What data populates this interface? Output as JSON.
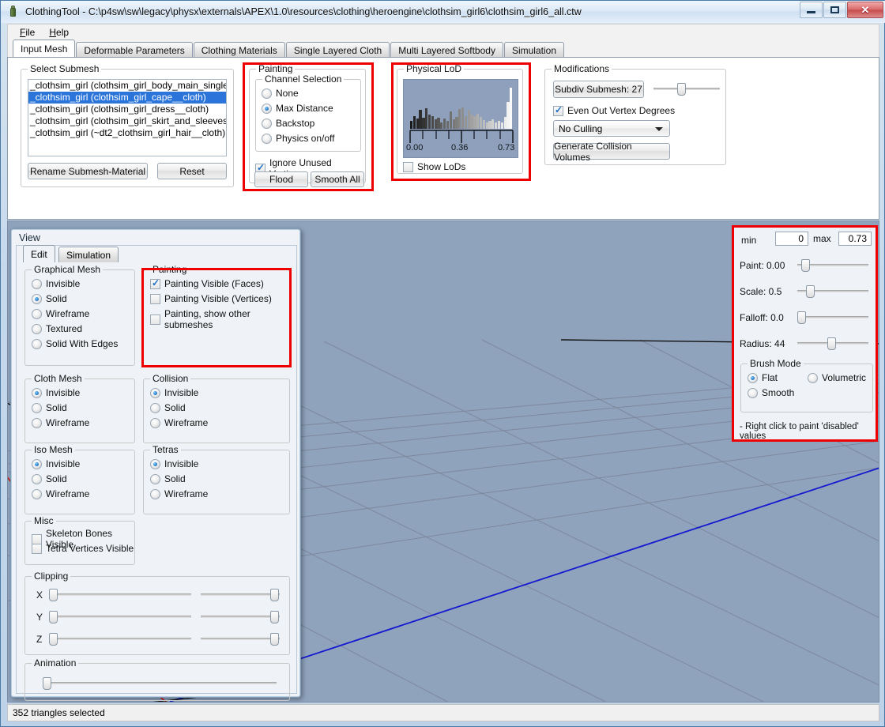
{
  "window": {
    "title": "ClothingTool - C:\\p4sw\\sw\\legacy\\physx\\externals\\APEX\\1.0\\resources\\clothing\\heroengine\\clothsim_girl6\\clothsim_girl6_all.ctw",
    "minimize_label": "Minimize",
    "maximize_label": "Maximize",
    "close_label": "✕",
    "app_icon": "clothing-tool-icon"
  },
  "menu": {
    "items": [
      "File",
      "Help"
    ]
  },
  "tabs": {
    "items": [
      "Input Mesh",
      "Deformable Parameters",
      "Clothing Materials",
      "Single Layered Cloth",
      "Multi Layered Softbody",
      "Simulation"
    ],
    "active": "Input Mesh"
  },
  "select_submesh": {
    "legend": "Select Submesh",
    "items": [
      "_clothsim_girl (clothsim_girl_body_main_single_s",
      "_clothsim_girl (clothsim_girl_cape__cloth)",
      "_clothsim_girl (clothsim_girl_dress__cloth)",
      "_clothsim_girl (clothsim_girl_skirt_and_sleeves__",
      "_clothsim_girl (~dt2_clothsim_girl_hair__cloth)"
    ],
    "selected_index": 1,
    "rename_button": "Rename Submesh-Material",
    "reset_button": "Reset"
  },
  "painting": {
    "legend": "Painting",
    "channel_legend": "Channel Selection",
    "channels": [
      "None",
      "Max Distance",
      "Backstop",
      "Physics on/off"
    ],
    "selected_channel": "Max Distance",
    "ignore_unused_vertices_label": "Ignore Unused Vertices",
    "ignore_unused_vertices_checked": true,
    "flood_button": "Flood",
    "smooth_all_button": "Smooth All"
  },
  "physical_lod": {
    "legend": "Physical LoD",
    "show_lods_label": "Show LoDs",
    "show_lods_checked": false,
    "axis_min_label": "0.00",
    "axis_mid_label": "0.36",
    "axis_max_label": "0.73"
  },
  "chart_data": {
    "type": "bar",
    "title": "Physical LoD",
    "xlabel": "",
    "ylabel": "",
    "xlim": [
      0.0,
      0.73
    ],
    "ylim": [
      0,
      100
    ],
    "grid": false,
    "legend": "none",
    "tick_labels": [
      "0.00",
      "0.36",
      "0.73"
    ],
    "tick_positions": [
      0.0,
      0.36,
      0.73
    ],
    "x": [
      0.05,
      0.07,
      0.09,
      0.11,
      0.13,
      0.15,
      0.17,
      0.19,
      0.21,
      0.23,
      0.25,
      0.27,
      0.29,
      0.31,
      0.33,
      0.35,
      0.37,
      0.39,
      0.41,
      0.43,
      0.45,
      0.47,
      0.49,
      0.51,
      0.53,
      0.55,
      0.57,
      0.59,
      0.61,
      0.63,
      0.65,
      0.67,
      0.69,
      0.71
    ],
    "values": [
      18,
      30,
      24,
      44,
      26,
      48,
      34,
      30,
      22,
      26,
      14,
      24,
      18,
      40,
      22,
      28,
      46,
      50,
      30,
      44,
      34,
      30,
      36,
      28,
      20,
      14,
      18,
      22,
      14,
      18,
      14,
      28,
      62,
      96
    ],
    "bar_colors_gradient": [
      "#1d1d1d",
      "#ffffff"
    ]
  },
  "modifications": {
    "legend": "Modifications",
    "subdiv_button": "Subdiv Submesh: 27",
    "subdiv_slider_value": 27,
    "even_out_label": "Even Out Vertex Degrees",
    "even_out_checked": true,
    "culling_value": "No Culling",
    "generate_button": "Generate Collision Volumes"
  },
  "view_panel": {
    "title": "View",
    "tabs": [
      "Edit",
      "Simulation"
    ],
    "active_tab": "Edit",
    "graphical_mesh": {
      "legend": "Graphical Mesh",
      "options": [
        "Invisible",
        "Solid",
        "Wireframe",
        "Textured",
        "Solid With Edges"
      ],
      "selected": "Solid"
    },
    "painting": {
      "legend": "Painting",
      "options": [
        {
          "label": "Painting Visible (Faces)",
          "checked": true
        },
        {
          "label": "Painting Visible (Vertices)",
          "checked": false
        },
        {
          "label": "Painting, show other submeshes",
          "checked": false
        }
      ]
    },
    "cloth_mesh": {
      "legend": "Cloth Mesh",
      "options": [
        "Invisible",
        "Solid",
        "Wireframe"
      ],
      "selected": "Invisible"
    },
    "collision": {
      "legend": "Collision",
      "options": [
        "Invisible",
        "Solid",
        "Wireframe"
      ],
      "selected": "Invisible"
    },
    "iso_mesh": {
      "legend": "Iso Mesh",
      "options": [
        "Invisible",
        "Solid",
        "Wireframe"
      ],
      "selected": "Invisible"
    },
    "tetras": {
      "legend": "Tetras",
      "options": [
        "Invisible",
        "Solid",
        "Wireframe"
      ],
      "selected": "Invisible"
    },
    "misc": {
      "legend": "Misc",
      "options": [
        {
          "label": "Skeleton Bones Visible",
          "checked": false
        },
        {
          "label": "Tetra Vertices Visible",
          "checked": false
        }
      ]
    },
    "clipping": {
      "legend": "Clipping",
      "axes": [
        "X",
        "Y",
        "Z"
      ]
    },
    "animation": {
      "legend": "Animation"
    }
  },
  "brush_panel": {
    "min_label": "min",
    "min_value": "0",
    "max_label": "max",
    "max_value": "0.73",
    "sliders": [
      {
        "label": "Paint: 0.00",
        "pos": 0.06
      },
      {
        "label": "Scale: 0.5",
        "pos": 0.12
      },
      {
        "label": "Falloff: 0.0",
        "pos": 0.0
      },
      {
        "label": "Radius: 44",
        "pos": 0.42
      }
    ],
    "brush_mode": {
      "legend": "Brush Mode",
      "options": [
        "Flat",
        "Volumetric",
        "Smooth"
      ],
      "selected": "Flat"
    },
    "hint": "- Right click to paint 'disabled' values"
  },
  "status": {
    "text": "352 triangles selected"
  },
  "colors": {
    "accent": "#2a74da",
    "highlight_box": "#ee0000",
    "viewport_bg": "#8fa3bd",
    "mesh_fill": "#6b2f28",
    "mesh_top": "#2ee8e8",
    "axis_x": "#dd1111",
    "axis_z": "#1111dd"
  }
}
